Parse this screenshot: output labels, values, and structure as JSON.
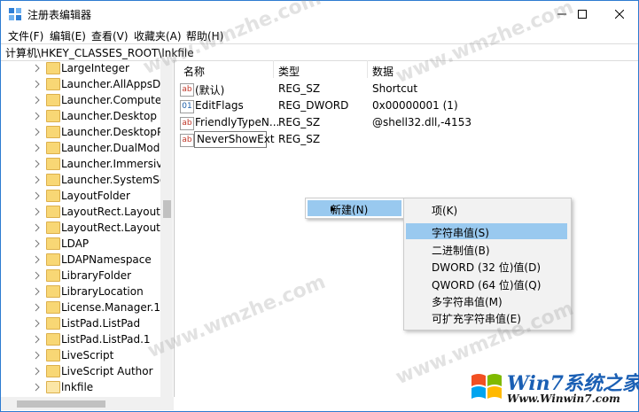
{
  "window": {
    "title": "注册表编辑器"
  },
  "menu": [
    "文件(F)",
    "编辑(E)",
    "查看(V)",
    "收藏夹(A)",
    "帮助(H)"
  ],
  "address": "计算机\\HKEY_CLASSES_ROOT\\lnkfile",
  "tree": {
    "items": [
      "LargeInteger",
      "Launcher.AllAppsDesk",
      "Launcher.Computer",
      "Launcher.Desktop",
      "Launcher.DesktopPac",
      "Launcher.DualModeA",
      "Launcher.ImmersiveA",
      "Launcher.SystemSetti",
      "LayoutFolder",
      "LayoutRect.LayoutRec",
      "LayoutRect.LayoutRec",
      "LDAP",
      "LDAPNamespace",
      "LibraryFolder",
      "LibraryLocation",
      "License.Manager.1",
      "ListPad.ListPad",
      "ListPad.ListPad.1",
      "LiveScript",
      "LiveScript Author",
      "lnkfile"
    ],
    "selected_index": 20
  },
  "list": {
    "headers": {
      "name": "名称",
      "type": "类型",
      "data": "数据"
    },
    "rows": [
      {
        "icon": "string-value-icon",
        "name": "(默认)",
        "type": "REG_SZ",
        "data": "Shortcut"
      },
      {
        "icon": "binary-value-icon",
        "name": "EditFlags",
        "type": "REG_DWORD",
        "data": "0x00000001 (1)"
      },
      {
        "icon": "string-value-icon",
        "name": "FriendlyTypeN...",
        "type": "REG_SZ",
        "data": "@shell32.dll,-4153"
      },
      {
        "icon": "string-value-icon",
        "name": "NeverShowExt",
        "type": "REG_SZ",
        "data": ""
      }
    ]
  },
  "context_menu": {
    "new_label": "新建(N)",
    "submenu": [
      "项(K)",
      "字符串值(S)",
      "二进制值(B)",
      "DWORD (32 位)值(D)",
      "QWORD (64 位)值(Q)",
      "多字符串值(M)",
      "可扩充字符串值(E)"
    ],
    "highlighted_index": 1
  },
  "watermark": "www.wmzhe.com",
  "brand": {
    "name": "Win7系统之家",
    "url": "Www.Winwin7.com"
  },
  "colors": {
    "selection": "#99c9ef",
    "folder": "#f8d775",
    "border": "#2d7bd1"
  }
}
